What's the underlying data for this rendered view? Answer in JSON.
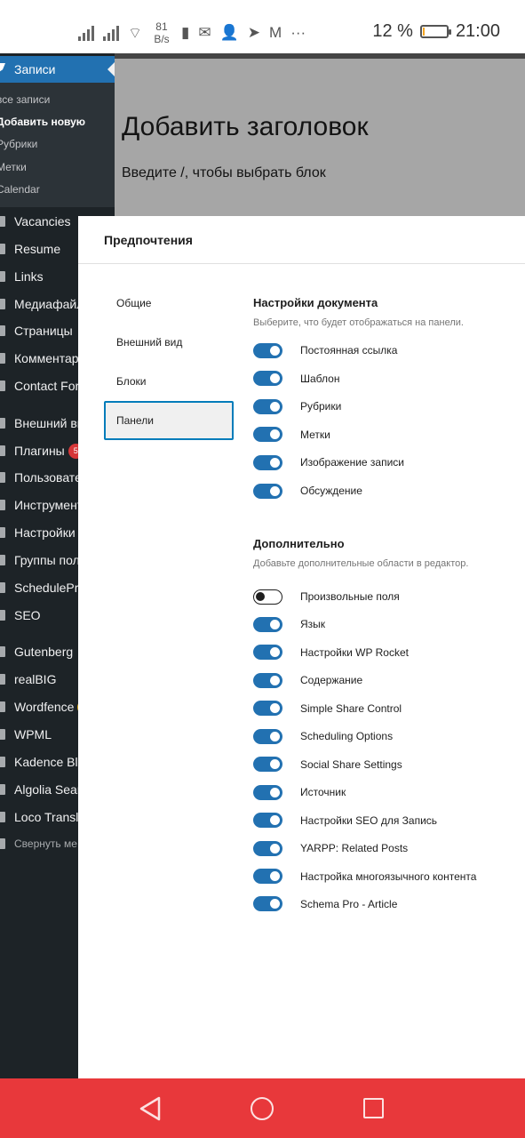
{
  "status_bar": {
    "speed_value": "81",
    "speed_unit": "B/s",
    "battery_percent": "12 %",
    "battery_level": 0.12,
    "time": "21:00",
    "icons": [
      "signal-icon",
      "signal-icon",
      "wifi-icon",
      "battery-alert-icon",
      "mail-icon",
      "add-person-icon",
      "telegram-icon",
      "gmail-icon",
      "more-icon"
    ]
  },
  "sidebar": {
    "active": "Записи",
    "submenu": [
      "все записи",
      "Добавить новую",
      "Рубрики",
      "Метки",
      "Calendar"
    ],
    "items": [
      {
        "label": "Vacancies"
      },
      {
        "label": "Resume"
      },
      {
        "label": "Links"
      },
      {
        "label": "Медиафайл"
      },
      {
        "label": "Страницы"
      },
      {
        "label": "Комментари"
      },
      {
        "label": "Contact Form"
      },
      {
        "label": "Внешний ви"
      },
      {
        "label": "Плагины",
        "badge": "5"
      },
      {
        "label": "Пользовате"
      },
      {
        "label": "Инструмент"
      },
      {
        "label": "Настройки"
      },
      {
        "label": "Группы поле"
      },
      {
        "label": "SchedulePre"
      },
      {
        "label": "SEO"
      },
      {
        "label": "Gutenberg"
      },
      {
        "label": "realBIG"
      },
      {
        "label": "Wordfence",
        "badge": ""
      },
      {
        "label": "WPML"
      },
      {
        "label": "Kadence Bloc"
      },
      {
        "label": "Algolia Searc"
      },
      {
        "label": "Loco Translat"
      },
      {
        "label": "Свернуть ме"
      }
    ]
  },
  "editor": {
    "title_placeholder": "Добавить заголовок",
    "block_hint": "Введите /, чтобы выбрать блок"
  },
  "modal": {
    "title": "Предпочтения",
    "tabs": [
      "Общие",
      "Внешний вид",
      "Блоки",
      "Панели"
    ],
    "active_tab": "Панели",
    "document_settings": {
      "title": "Настройки документа",
      "description": "Выберите, что будет отображаться на панели.",
      "options": [
        {
          "label": "Постоянная ссылка",
          "on": true
        },
        {
          "label": "Шаблон",
          "on": true
        },
        {
          "label": "Рубрики",
          "on": true
        },
        {
          "label": "Метки",
          "on": true
        },
        {
          "label": "Изображение записи",
          "on": true
        },
        {
          "label": "Обсуждение",
          "on": true
        }
      ]
    },
    "additional": {
      "title": "Дополнительно",
      "description": "Добавьте дополнительные области в редактор.",
      "options": [
        {
          "label": "Произвольные поля",
          "on": false
        },
        {
          "label": "Язык",
          "on": true
        },
        {
          "label": "Настройки WP Rocket",
          "on": true
        },
        {
          "label": "Содержание",
          "on": true
        },
        {
          "label": "Simple Share Control",
          "on": true
        },
        {
          "label": "Scheduling Options",
          "on": true
        },
        {
          "label": "Social Share Settings",
          "on": true
        },
        {
          "label": "Источник",
          "on": true
        },
        {
          "label": "Настройки SEO для Запись",
          "on": true
        },
        {
          "label": "YARPP: Related Posts",
          "on": true
        },
        {
          "label": "Настройка многоязычного контента",
          "on": true
        },
        {
          "label": "Schema Pro - Article",
          "on": true
        }
      ]
    }
  },
  "nav_bar": {
    "buttons": [
      "back-icon",
      "home-icon",
      "recents-icon"
    ]
  }
}
